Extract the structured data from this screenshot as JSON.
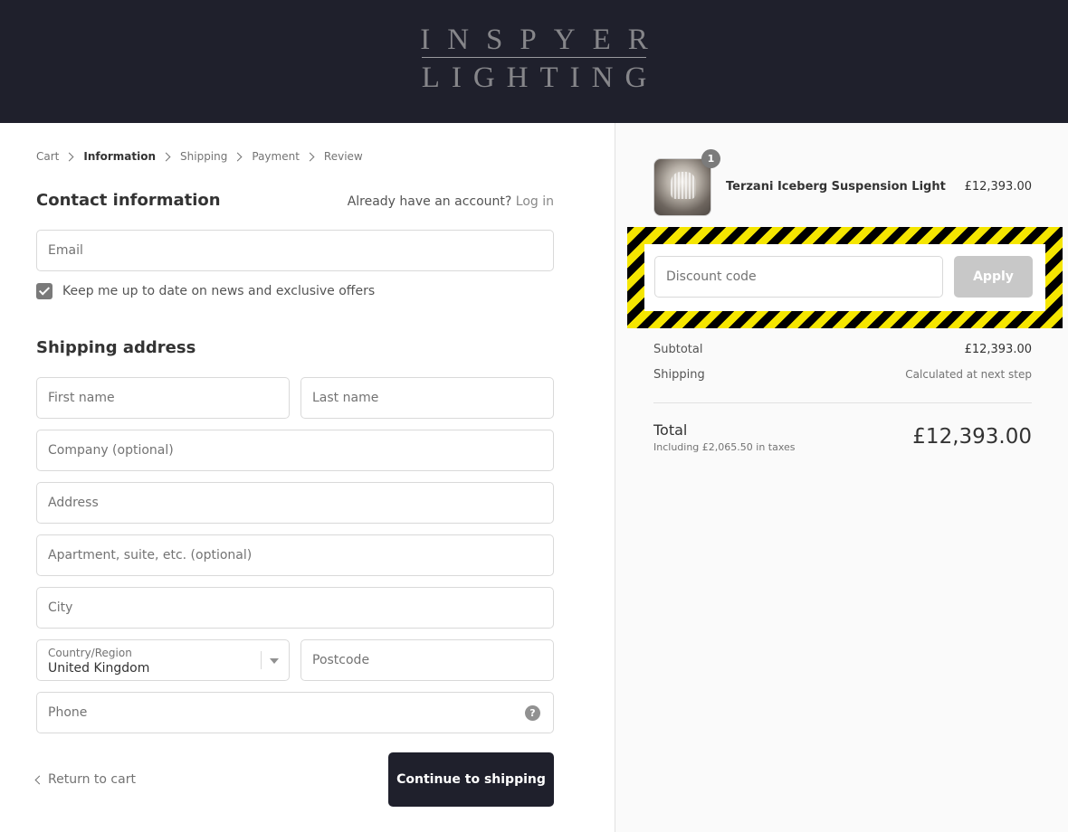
{
  "brand": {
    "line1": "INSPYER",
    "line2": "LIGHTING"
  },
  "breadcrumb": [
    {
      "label": "Cart"
    },
    {
      "label": "Information"
    },
    {
      "label": "Shipping"
    },
    {
      "label": "Payment"
    },
    {
      "label": "Review"
    }
  ],
  "contact": {
    "title": "Contact information",
    "account_prompt": "Already have an account?",
    "login_link": "Log in",
    "email_placeholder": "Email",
    "newsletter_label": "Keep me up to date on news and exclusive offers",
    "newsletter_checked": true
  },
  "shipping": {
    "title": "Shipping address",
    "first_name_placeholder": "First name",
    "last_name_placeholder": "Last name",
    "company_placeholder": "Company (optional)",
    "address_placeholder": "Address",
    "apartment_placeholder": "Apartment, suite, etc. (optional)",
    "city_placeholder": "City",
    "country_label": "Country/Region",
    "country_value": "United Kingdom",
    "postcode_placeholder": "Postcode",
    "phone_placeholder": "Phone"
  },
  "actions": {
    "return_label": "Return to cart",
    "continue_label": "Continue to shipping"
  },
  "order": {
    "item": {
      "name": "Terzani Iceberg Suspension Light",
      "price": "£12,393.00",
      "quantity": "1"
    },
    "discount_placeholder": "Discount code",
    "apply_label": "Apply",
    "subtotal_label": "Subtotal",
    "subtotal_value": "£12,393.00",
    "shipping_label": "Shipping",
    "shipping_value": "Calculated at next step",
    "total_label": "Total",
    "tax_note": "Including £2,065.50 in taxes",
    "total_value": "£12,393.00"
  },
  "colors": {
    "header_bg": "#1f202c",
    "button_bg": "#1f202c",
    "apply_bg": "#c8c8c8",
    "highlight_stripe_1": "#000000",
    "highlight_stripe_2": "#f5e600"
  }
}
